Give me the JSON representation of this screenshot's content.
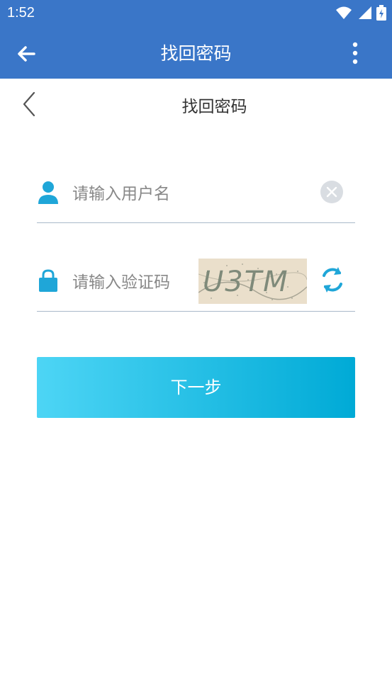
{
  "status": {
    "time": "1:52",
    "icons": [
      "wifi-icon",
      "signal-icon",
      "battery-icon"
    ]
  },
  "app_bar": {
    "title": "找回密码",
    "color": "#3a76c8"
  },
  "sub_header": {
    "title": "找回密码"
  },
  "form": {
    "username_placeholder": "请输入用户名",
    "captcha_placeholder": "请输入验证码",
    "captcha_text": "U3TM"
  },
  "actions": {
    "next_label": "下一步"
  },
  "colors": {
    "accent": "#1fa6d8",
    "button_start": "#4dd5f5",
    "button_end": "#00aad6"
  }
}
